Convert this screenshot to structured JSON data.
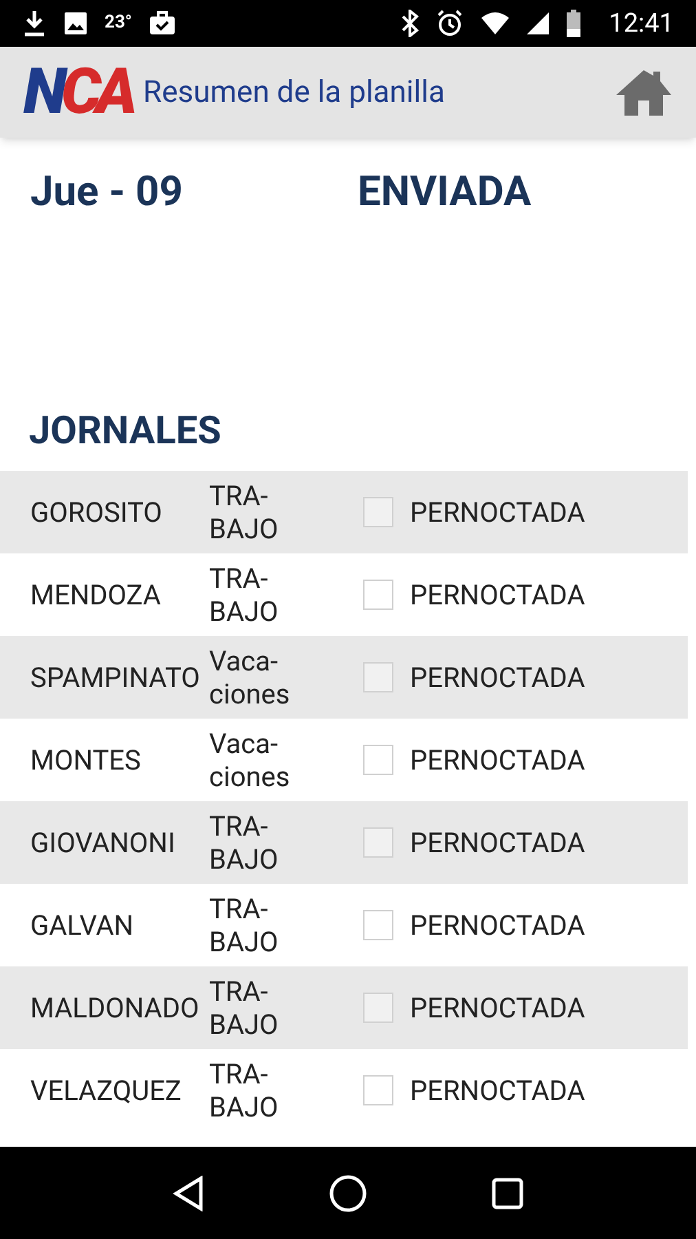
{
  "status_bar": {
    "temperature": "23°",
    "time": "12:41"
  },
  "app_bar": {
    "logo": "NCA",
    "title": "Resumen de la planilla"
  },
  "summary": {
    "date": "Jue - 09",
    "status": "ENVIADA"
  },
  "section_title": "JORNALES",
  "rows": [
    {
      "name": "GOROSITO",
      "type": "TRA-BAJO",
      "checkbox_label": "PERNOCTADA",
      "checked": false
    },
    {
      "name": "MENDOZA",
      "type": "TRA-BAJO",
      "checkbox_label": "PERNOCTADA",
      "checked": false
    },
    {
      "name": "SPAMPINATO",
      "type": "Vaca-ciones",
      "checkbox_label": "PERNOCTADA",
      "checked": false
    },
    {
      "name": "MONTES",
      "type": "Vaca-ciones",
      "checkbox_label": "PERNOCTADA",
      "checked": false
    },
    {
      "name": "GIOVANONI",
      "type": "TRA-BAJO",
      "checkbox_label": "PERNOCTADA",
      "checked": false
    },
    {
      "name": "GALVAN",
      "type": "TRA-BAJO",
      "checkbox_label": "PERNOCTADA",
      "checked": false
    },
    {
      "name": "MALDONADO",
      "type": "TRA-BAJO",
      "checkbox_label": "PERNOCTADA",
      "checked": false
    },
    {
      "name": "VELAZQUEZ",
      "type": "TRA-BAJO",
      "checkbox_label": "PERNOCTADA",
      "checked": false
    }
  ]
}
